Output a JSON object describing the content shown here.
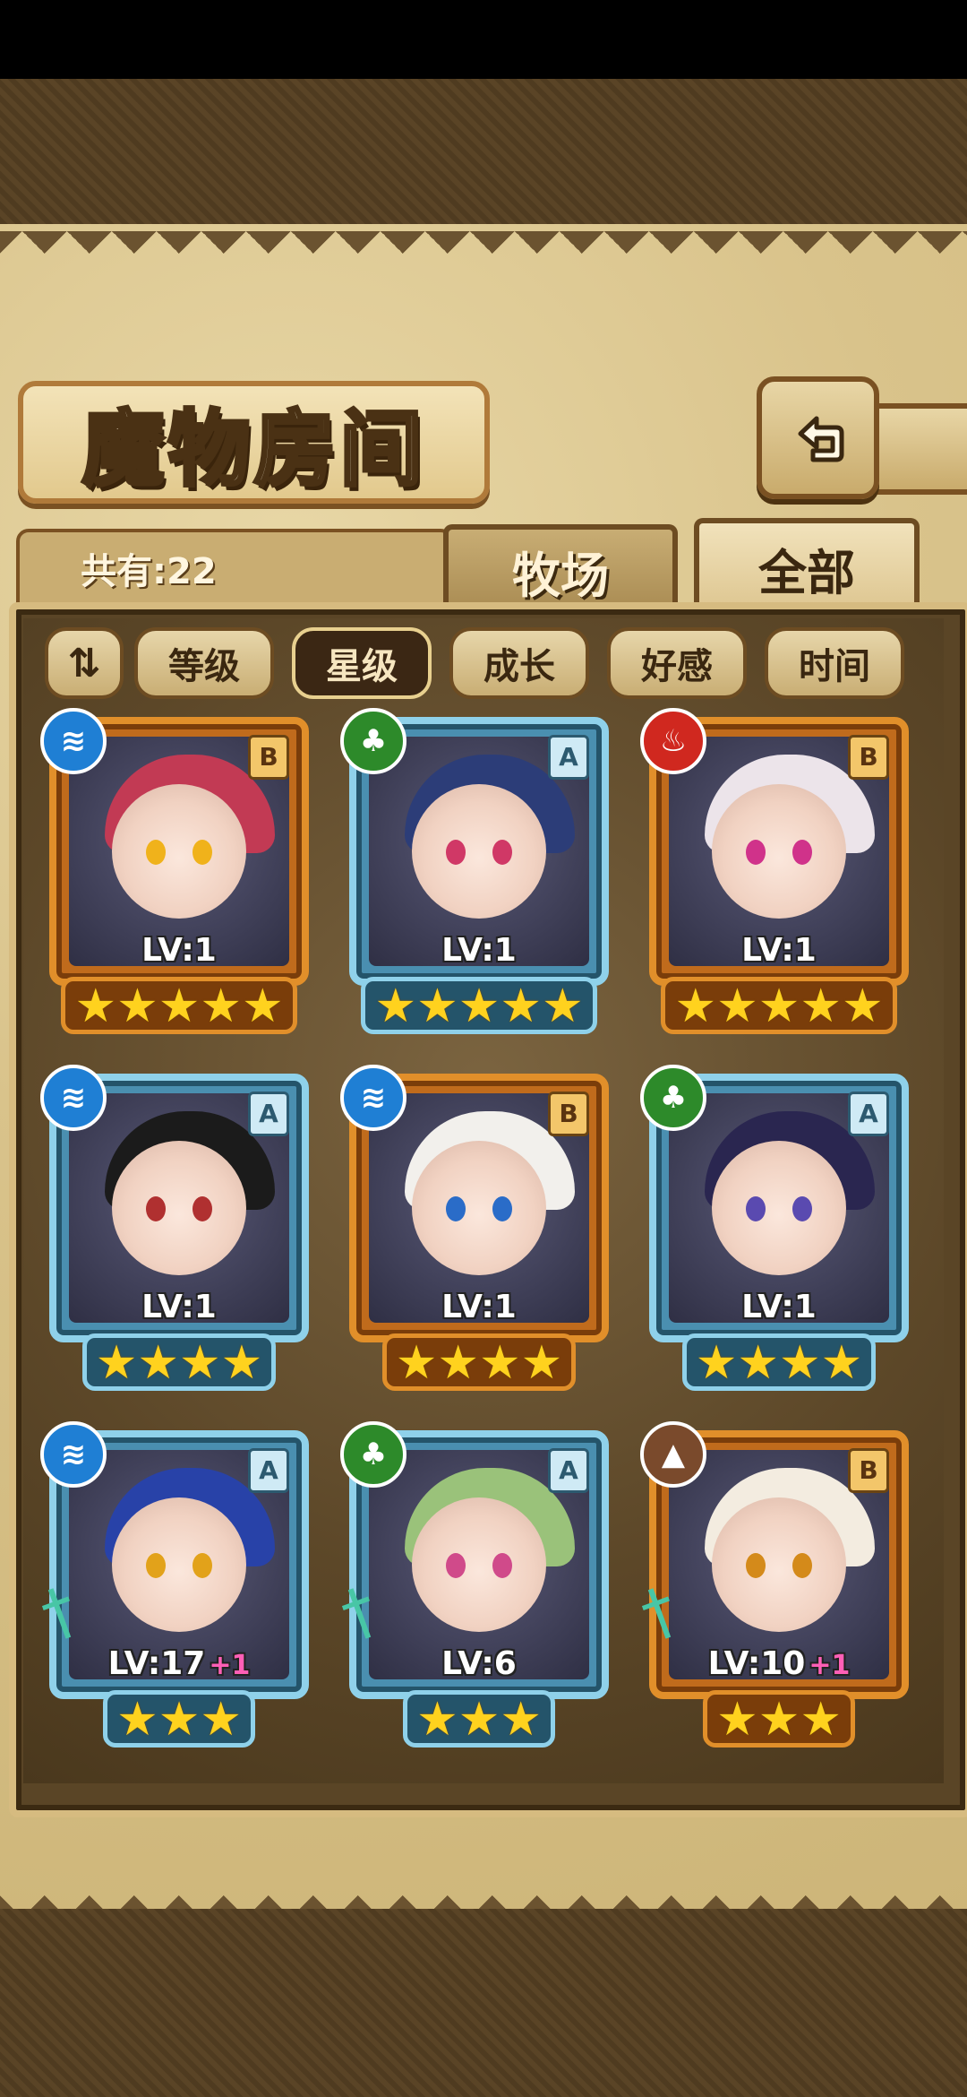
{
  "header": {
    "title": "魔物房间",
    "back_icon": "back-arrow-icon"
  },
  "summary": {
    "count_label": "共有:22"
  },
  "tabs": [
    {
      "label": "牧场",
      "active": false
    },
    {
      "label": "全部",
      "active": true
    }
  ],
  "filters": {
    "toggle_icon": "sort-order-icon",
    "toggle_glyph": "⇅",
    "items": [
      {
        "label": "等级",
        "active": false
      },
      {
        "label": "星级",
        "active": true
      },
      {
        "label": "成长",
        "active": false
      },
      {
        "label": "好感",
        "active": false
      },
      {
        "label": "时间",
        "active": false
      }
    ]
  },
  "monsters": [
    {
      "level": "LV:1",
      "bonus": "",
      "rank": "B",
      "element": "water",
      "stars": 5,
      "frame": "orange",
      "hair": "#c23a54",
      "eye": "#f0b21b",
      "weapon": false
    },
    {
      "level": "LV:1",
      "bonus": "",
      "rank": "A",
      "element": "wood",
      "stars": 5,
      "frame": "blue",
      "hair": "#2c3d78",
      "eye": "#d03866",
      "weapon": false
    },
    {
      "level": "LV:1",
      "bonus": "",
      "rank": "B",
      "element": "fire",
      "stars": 5,
      "frame": "orange",
      "hair": "#ece4ea",
      "eye": "#d0328a",
      "weapon": false
    },
    {
      "level": "LV:1",
      "bonus": "",
      "rank": "A",
      "element": "water",
      "stars": 4,
      "frame": "blue",
      "hair": "#1b1b1b",
      "eye": "#b03030",
      "weapon": false
    },
    {
      "level": "LV:1",
      "bonus": "",
      "rank": "B",
      "element": "water",
      "stars": 4,
      "frame": "orange",
      "hair": "#f2f0ec",
      "eye": "#2a6cc8",
      "weapon": false
    },
    {
      "level": "LV:1",
      "bonus": "",
      "rank": "A",
      "element": "wood",
      "stars": 4,
      "frame": "blue",
      "hair": "#2a2650",
      "eye": "#5a4ab0",
      "weapon": false
    },
    {
      "level": "LV:17",
      "bonus": "+1",
      "rank": "A",
      "element": "water",
      "stars": 3,
      "frame": "blue",
      "hair": "#2842a8",
      "eye": "#e2a21a",
      "weapon": true
    },
    {
      "level": "LV:6",
      "bonus": "",
      "rank": "A",
      "element": "wood",
      "stars": 3,
      "frame": "blue",
      "hair": "#9ac27a",
      "eye": "#d04a8a",
      "weapon": true
    },
    {
      "level": "LV:10",
      "bonus": "+1",
      "rank": "B",
      "element": "earth",
      "stars": 3,
      "frame": "orange",
      "hair": "#f3ece0",
      "eye": "#d48a1a",
      "weapon": true
    }
  ]
}
